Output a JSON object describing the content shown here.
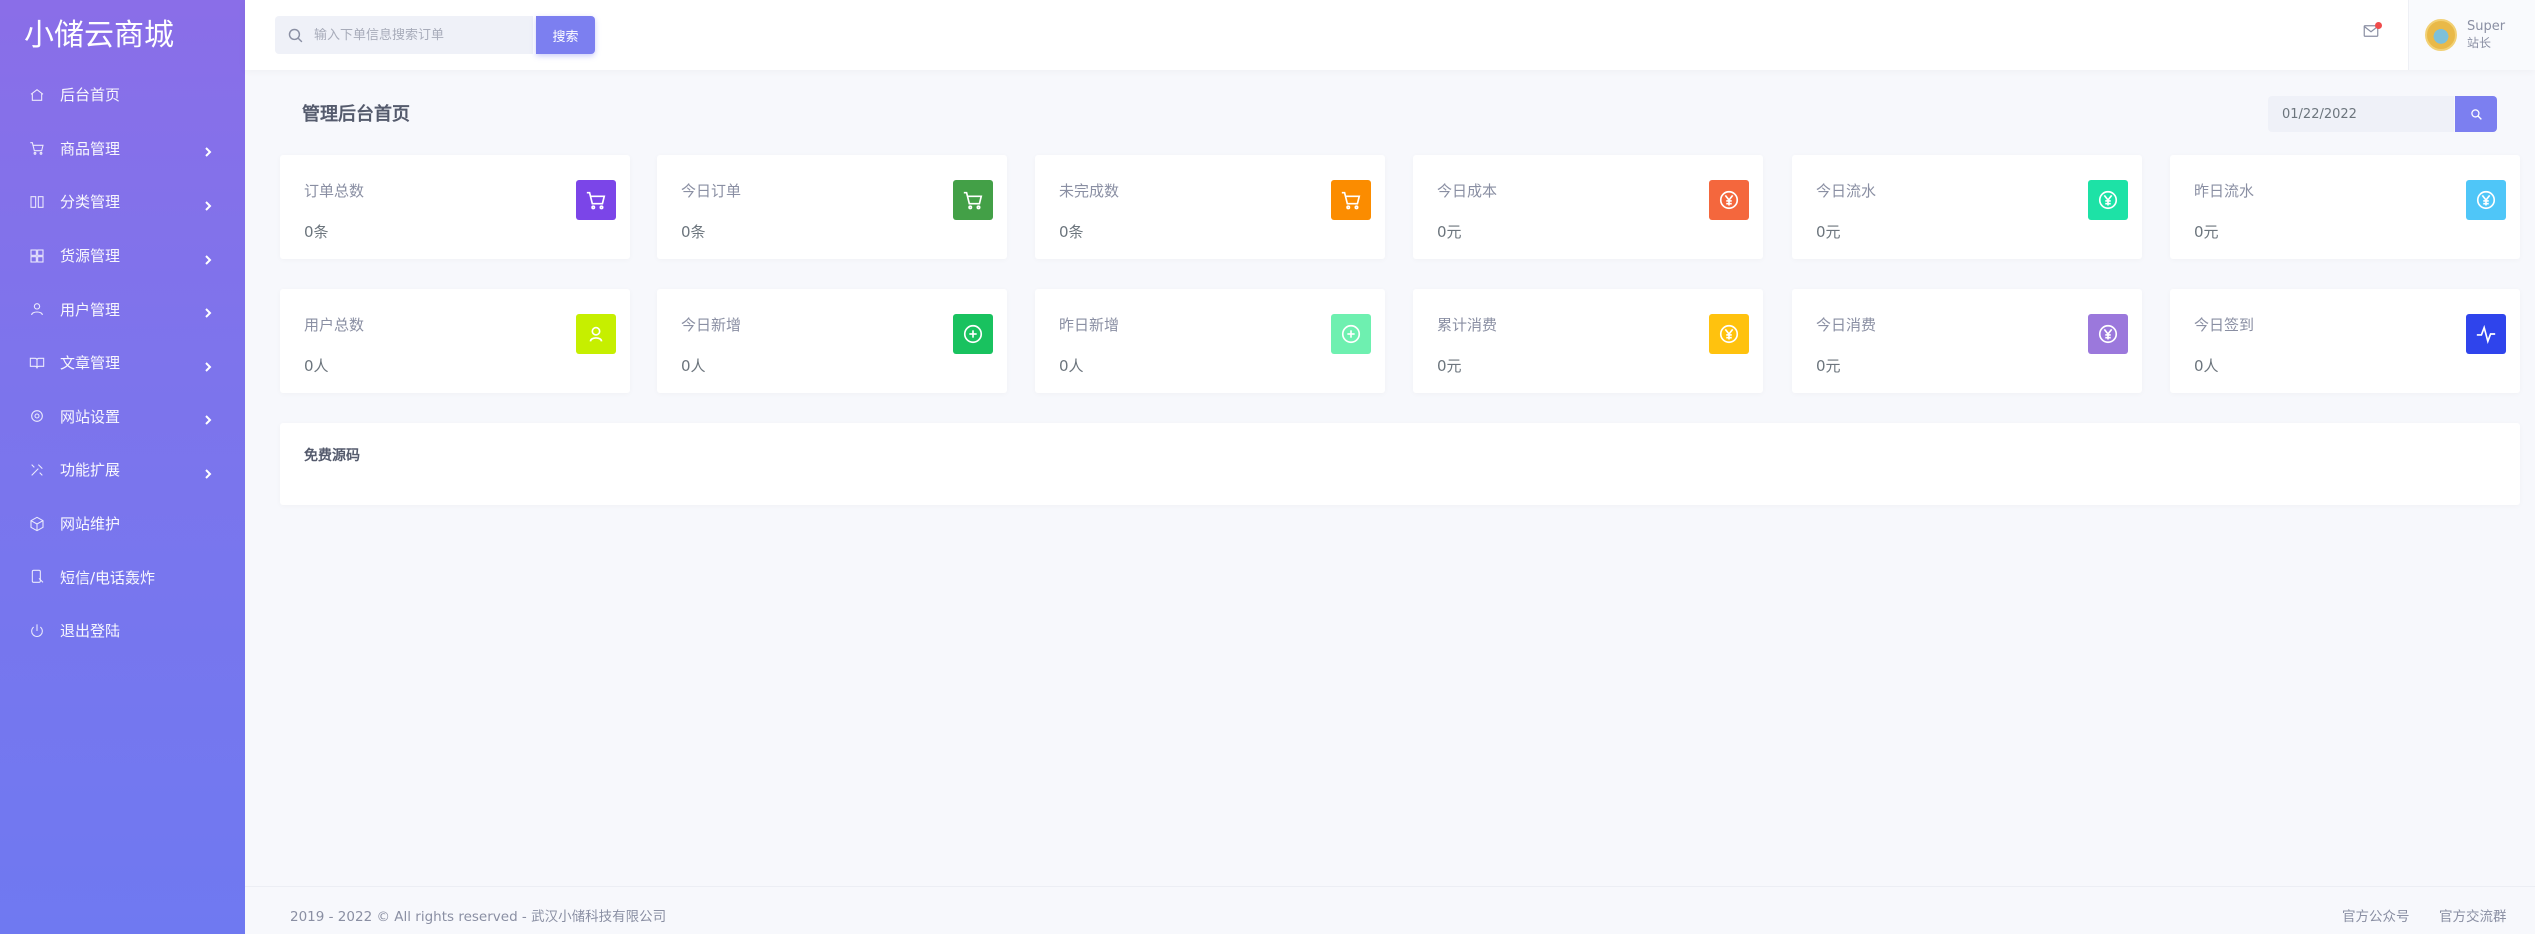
{
  "brand": "小储云商城",
  "sidebar": {
    "items": [
      {
        "label": "后台首页",
        "has_children": false
      },
      {
        "label": "商品管理",
        "has_children": true
      },
      {
        "label": "分类管理",
        "has_children": true
      },
      {
        "label": "货源管理",
        "has_children": true
      },
      {
        "label": "用户管理",
        "has_children": true
      },
      {
        "label": "文章管理",
        "has_children": true
      },
      {
        "label": "网站设置",
        "has_children": true
      },
      {
        "label": "功能扩展",
        "has_children": true
      },
      {
        "label": "网站维护",
        "has_children": false
      },
      {
        "label": "短信/电话轰炸",
        "has_children": false
      },
      {
        "label": "退出登陆",
        "has_children": false
      }
    ]
  },
  "topbar": {
    "search_placeholder": "输入下单信息搜索订单",
    "search_button": "搜索",
    "user": {
      "name": "Super",
      "role": "站长"
    }
  },
  "main": {
    "title": "管理后台首页",
    "date": "01/22/2022"
  },
  "stats": [
    {
      "label": "订单总数",
      "value": "0条",
      "icon": "cart-icon",
      "color": "#7b45e8"
    },
    {
      "label": "今日订单",
      "value": "0条",
      "icon": "cart-icon",
      "color": "#43a047"
    },
    {
      "label": "未完成数",
      "value": "0条",
      "icon": "cart-icon",
      "color": "#fb8c00"
    },
    {
      "label": "今日成本",
      "value": "0元",
      "icon": "yen-icon",
      "color": "#f4673d"
    },
    {
      "label": "今日流水",
      "value": "0元",
      "icon": "yen-icon",
      "color": "#1de2a6"
    },
    {
      "label": "昨日流水",
      "value": "0元",
      "icon": "yen-icon",
      "color": "#4fc6f8"
    },
    {
      "label": "用户总数",
      "value": "0人",
      "icon": "user-icon",
      "color": "#c6ef00"
    },
    {
      "label": "今日新增",
      "value": "0人",
      "icon": "plus-circle-icon",
      "color": "#19c25f"
    },
    {
      "label": "昨日新增",
      "value": "0人",
      "icon": "plus-circle-icon",
      "color": "#6ef0b0"
    },
    {
      "label": "累计消费",
      "value": "0元",
      "icon": "yen-icon",
      "color": "#ffc20e"
    },
    {
      "label": "今日消费",
      "value": "0元",
      "icon": "yen-icon",
      "color": "#9b78dc"
    },
    {
      "label": "今日签到",
      "value": "0人",
      "icon": "pulse-icon",
      "color": "#2f44ec"
    }
  ],
  "panel": {
    "title": "免费源码"
  },
  "footer": {
    "copyright": "2019 - 2022 © All rights reserved - 武汉小储科技有限公司",
    "link1": "官方公众号",
    "link2": "官方交流群"
  }
}
